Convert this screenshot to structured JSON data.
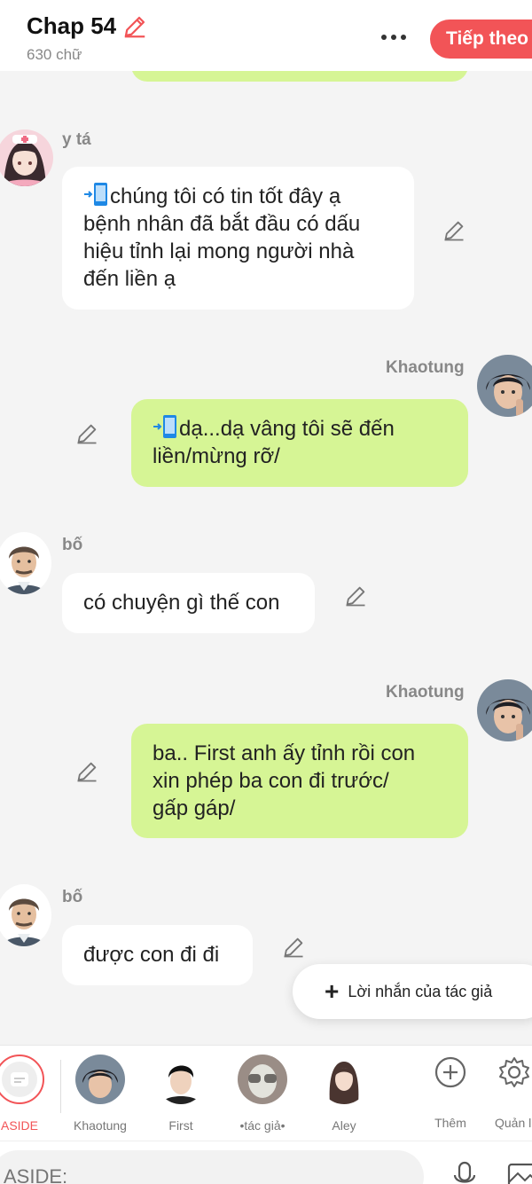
{
  "header": {
    "title": "Chap 54",
    "word_count": "630 chữ",
    "next_label": "Tiếp theo"
  },
  "messages": [
    {
      "speaker": "y tá",
      "text": "chúng tôi có tin tốt đây ạ bệnh nhân đã bắt đầu có dấu hiệu tỉnh lại mong người nhà đến liền ạ",
      "lines": [
        "chúng tôi có tin tốt đây ạ",
        "bệnh nhân đã bắt đầu có dấu",
        "hiệu tỉnh lại mong người nhà",
        "đến liền ạ"
      ],
      "side": "left",
      "has_phone_emoji": true
    },
    {
      "speaker": "Khaotung",
      "lines": [
        "dạ...dạ vâng tôi sẽ đến",
        "liền/mừng rỡ/"
      ],
      "side": "right",
      "has_phone_emoji": true
    },
    {
      "speaker": "bố",
      "lines": [
        "có chuyện gì thế con"
      ],
      "side": "left",
      "has_phone_emoji": false
    },
    {
      "speaker": "Khaotung",
      "lines": [
        "ba.. First anh ấy tỉnh rồi con",
        "xin phép ba con đi trước/",
        "gấp gáp/"
      ],
      "side": "right",
      "has_phone_emoji": false
    },
    {
      "speaker": "bố",
      "lines": [
        "được con đi đi"
      ],
      "side": "left",
      "has_phone_emoji": false
    }
  ],
  "author_note": {
    "label": "Lời nhắn của tác giả"
  },
  "characters": [
    {
      "label": "ASIDE"
    },
    {
      "label": "Khaotung"
    },
    {
      "label": "First"
    },
    {
      "label": "•tác giả•"
    },
    {
      "label": "Aley"
    },
    {
      "label": "Thêm"
    },
    {
      "label": "Quản l"
    }
  ],
  "input": {
    "placeholder": "ASIDE:"
  },
  "colors": {
    "accent": "#f25457",
    "bubble_right": "#d6f595",
    "bubble_left": "#ffffff",
    "background": "#f4f4f4"
  }
}
